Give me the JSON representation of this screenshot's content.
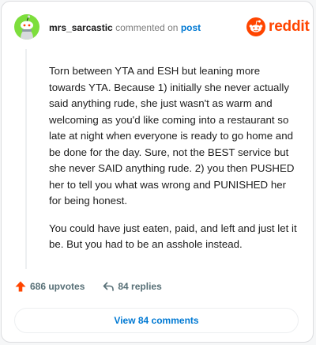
{
  "header": {
    "username": "mrs_sarcastic",
    "action_text": "commented on",
    "post_link": "post"
  },
  "logo": {
    "wordmark": "reddit",
    "icon": "reddit-snoo-icon"
  },
  "comment": {
    "paragraphs": [
      "Torn between YTA and ESH but leaning more towards YTA. Because 1) initially she never actually said anything rude, she just wasn't as warm and welcoming as you'd like coming into a restaurant so late at night when everyone is ready to go home and be done for the day. Sure, not the BEST service but she never SAID anything rude. 2) you then PUSHED her to tell you what was wrong and PUNISHED her for being honest.",
      "You could have just eaten, paid, and left and just let it be. But you had to be an asshole instead."
    ]
  },
  "actions": {
    "upvotes": "686 upvotes",
    "upvote_icon": "upvote-arrow-icon",
    "replies": "84 replies",
    "reply_icon": "reply-arrow-icon"
  },
  "view_button": {
    "label": "View 84 comments"
  },
  "colors": {
    "brand": "#ff4500",
    "link": "#0079d3",
    "avatar_bg": "#7dde3c"
  }
}
